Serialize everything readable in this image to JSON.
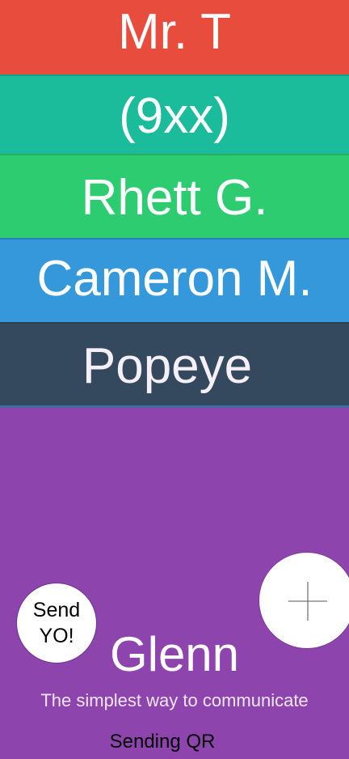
{
  "contacts": [
    {
      "name": "Mr. T",
      "color": "#e74c3c"
    },
    {
      "name": "(9xx)",
      "color": "#1abc9c"
    },
    {
      "name": "Rhett G.",
      "color": "#2ecc71"
    },
    {
      "name": "Cameron M.",
      "color": "#3498db"
    },
    {
      "name": "Popeye",
      "color": "#34495e"
    }
  ],
  "profile": {
    "username": "Glenn",
    "tagline": "The simplest way to communicate",
    "background_color": "#8e44ad"
  },
  "actions": {
    "send_yo_line1": "Send",
    "send_yo_line2": "YO!",
    "add_icon": "plus-icon",
    "sending_qr_label": "Sending QR"
  }
}
